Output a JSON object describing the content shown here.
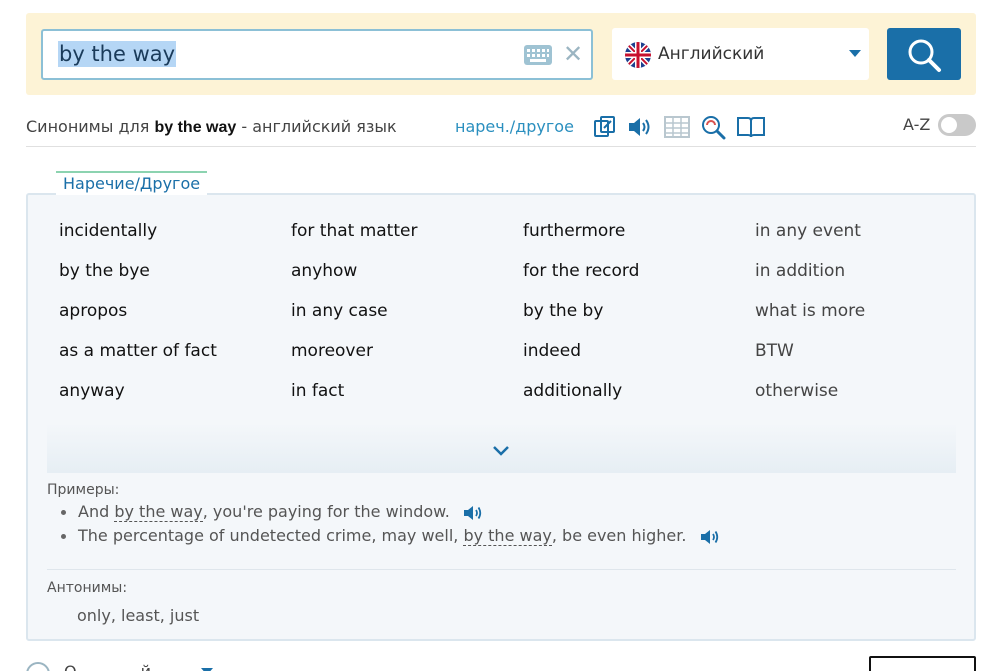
{
  "search": {
    "query": "by the way",
    "language": "Английский"
  },
  "header": {
    "prefix": "Синонимы для",
    "term": "by the way",
    "suffix": "- английский язык",
    "pos_link": "нареч./другое",
    "az_label": "A-Z"
  },
  "tab": {
    "label": "Наречие/Другое"
  },
  "synonyms": {
    "columns": [
      [
        "incidentally",
        "by the bye",
        "apropos",
        "as a matter of fact",
        "anyway"
      ],
      [
        "for that matter",
        "anyhow",
        "in any case",
        "moreover",
        "in fact"
      ],
      [
        "furthermore",
        "for the record",
        "by the by",
        "indeed",
        "additionally"
      ],
      [
        "in any event",
        "in addition",
        "what is more",
        "BTW",
        "otherwise"
      ]
    ]
  },
  "examples": {
    "title": "Примеры:",
    "items": [
      {
        "before": "And ",
        "highlight": "by the way",
        "after": ", you're paying for the window."
      },
      {
        "before": "The percentage of undetected crime, may well, ",
        "highlight": "by the way",
        "after": ", be even higher."
      }
    ]
  },
  "antonyms": {
    "title": "Антонимы:",
    "list": "only, least, just"
  },
  "footer": {
    "text": "О…………й"
  },
  "colors": {
    "accent": "#1a6fa8",
    "panel": "#fdf3d6",
    "link": "#2a8fbf"
  }
}
